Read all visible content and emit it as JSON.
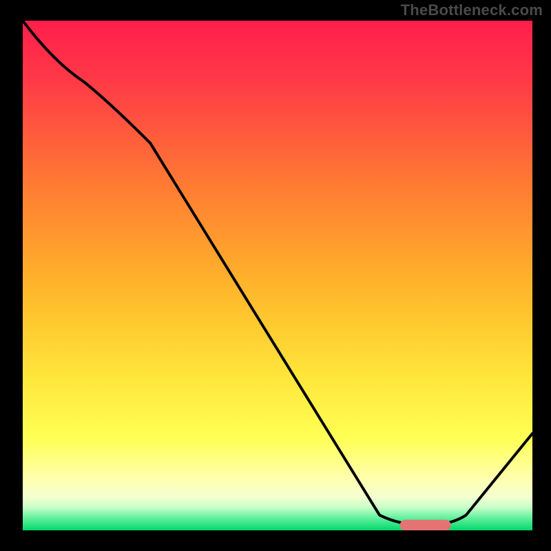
{
  "watermark": "TheBottleneck.com",
  "colors": {
    "gradient_top": "#ff1e4b",
    "gradient_mid1": "#ff8a2b",
    "gradient_mid2": "#ffff40",
    "gradient_pale": "#ffffa8",
    "gradient_green": "#00e676",
    "curve": "#000000",
    "marker": "#e57373",
    "background": "#000000"
  },
  "chart_data": {
    "type": "line",
    "title": "",
    "xlabel": "",
    "ylabel": "",
    "xlim": [
      0,
      100
    ],
    "ylim": [
      0,
      100
    ],
    "grid": false,
    "legend": false,
    "x": [
      0,
      12,
      25,
      74,
      84,
      100
    ],
    "values": [
      100,
      88,
      76,
      1,
      1,
      19
    ],
    "marker_segment": {
      "x_start": 74,
      "x_end": 84,
      "y": 1
    },
    "notes": "y is percentage-like height read from the vertical gradient; a flat minimum ≈1 lies between x≈74–84 marked by a short rounded pink bar, then the curve rises again toward x=100."
  }
}
